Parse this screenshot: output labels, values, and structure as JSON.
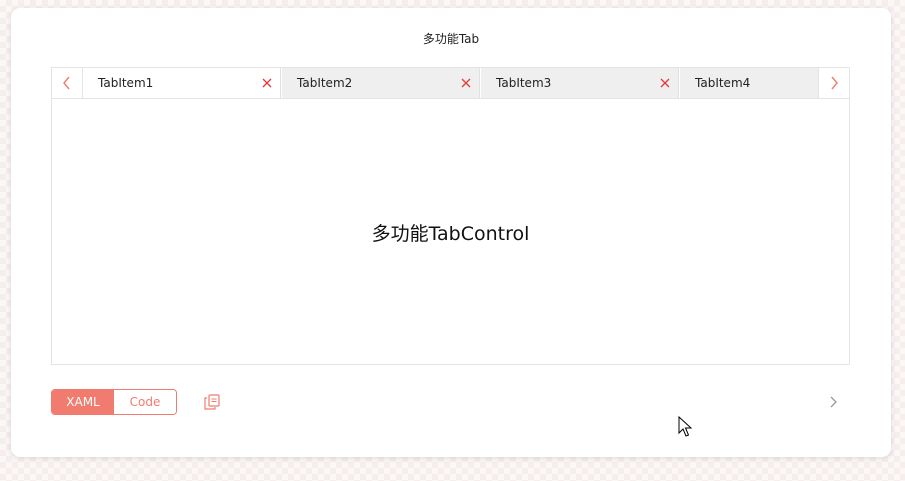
{
  "panel": {
    "title": "多功能Tab"
  },
  "tab_control": {
    "tabs": [
      {
        "label": "TabItem1",
        "active": true
      },
      {
        "label": "TabItem2",
        "active": false
      },
      {
        "label": "TabItem3",
        "active": false
      },
      {
        "label": "TabItem4",
        "active": false
      }
    ],
    "content_text": "多功能TabControl",
    "nav_icons": {
      "left": "chevron-left-icon",
      "right": "chevron-right-icon"
    },
    "close_icon": "close-icon"
  },
  "footer": {
    "toggle": {
      "xaml_label": "XAML",
      "code_label": "Code",
      "selected": "XAML"
    },
    "copy_icon": "copy-icon",
    "expand_icon": "chevron-right-icon"
  },
  "colors": {
    "accent": "#f07b6e",
    "close_red": "#e53935",
    "inactive_tab": "#efefef",
    "border": "#e4e4e4"
  }
}
